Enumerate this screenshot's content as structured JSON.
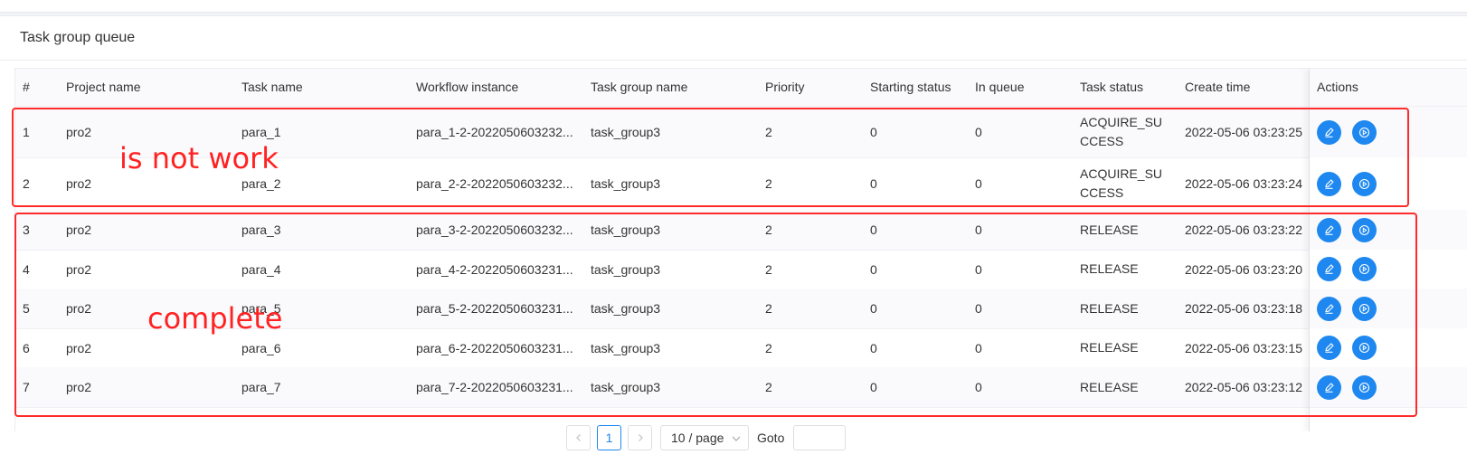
{
  "card": {
    "title": "Task group queue"
  },
  "table": {
    "columns": [
      "#",
      "Project name",
      "Task name",
      "Workflow instance",
      "Task group name",
      "Priority",
      "Starting status",
      "In queue",
      "Task status",
      "Create time",
      "Actions"
    ],
    "rows": [
      {
        "idx": "1",
        "project": "pro2",
        "task": "para_1",
        "workflow": "para_1-2-2022050603232...",
        "group": "task_group3",
        "priority": "2",
        "starting": "0",
        "queue": "0",
        "status": "ACQUIRE_SUCCESS",
        "time": "2022-05-06 03:23:25"
      },
      {
        "idx": "2",
        "project": "pro2",
        "task": "para_2",
        "workflow": "para_2-2-2022050603232...",
        "group": "task_group3",
        "priority": "2",
        "starting": "0",
        "queue": "0",
        "status": "ACQUIRE_SUCCESS",
        "time": "2022-05-06 03:23:24"
      },
      {
        "idx": "3",
        "project": "pro2",
        "task": "para_3",
        "workflow": "para_3-2-2022050603232...",
        "group": "task_group3",
        "priority": "2",
        "starting": "0",
        "queue": "0",
        "status": "RELEASE",
        "time": "2022-05-06 03:23:22"
      },
      {
        "idx": "4",
        "project": "pro2",
        "task": "para_4",
        "workflow": "para_4-2-2022050603231...",
        "group": "task_group3",
        "priority": "2",
        "starting": "0",
        "queue": "0",
        "status": "RELEASE",
        "time": "2022-05-06 03:23:20"
      },
      {
        "idx": "5",
        "project": "pro2",
        "task": "para_5",
        "workflow": "para_5-2-2022050603231...",
        "group": "task_group3",
        "priority": "2",
        "starting": "0",
        "queue": "0",
        "status": "RELEASE",
        "time": "2022-05-06 03:23:18"
      },
      {
        "idx": "6",
        "project": "pro2",
        "task": "para_6",
        "workflow": "para_6-2-2022050603231...",
        "group": "task_group3",
        "priority": "2",
        "starting": "0",
        "queue": "0",
        "status": "RELEASE",
        "time": "2022-05-06 03:23:15"
      },
      {
        "idx": "7",
        "project": "pro2",
        "task": "para_7",
        "workflow": "para_7-2-2022050603231...",
        "group": "task_group3",
        "priority": "2",
        "starting": "0",
        "queue": "0",
        "status": "RELEASE",
        "time": "2022-05-06 03:23:12"
      }
    ]
  },
  "annotations": {
    "not_work": "is not work",
    "complete": "complete"
  },
  "pagination": {
    "current_page": "1",
    "page_size": "10 / page",
    "goto_label": "Goto",
    "goto_value": ""
  },
  "colors": {
    "accent": "#1e88f0",
    "annotation": "#ff2a2a"
  },
  "icons": {
    "edit": "edit-icon",
    "start": "play-circle-icon",
    "prev": "chevron-left-icon",
    "next": "chevron-right-icon",
    "dropdown": "chevron-down-icon"
  }
}
